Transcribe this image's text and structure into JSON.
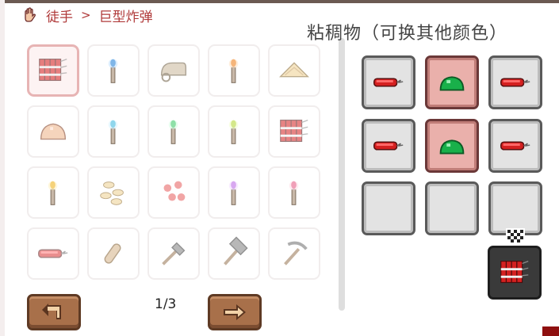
{
  "breadcrumb": {
    "root": "徒手",
    "separator": ">",
    "current": "巨型炸弹"
  },
  "recipe": {
    "title": "粘稠物（可换其他颜色）"
  },
  "pagination": {
    "page": "1/3"
  },
  "item_grid": [
    [
      "dynamite-bundle-icon",
      "blue-torch-icon",
      "grappling-hook-icon",
      "orange-torch-icon",
      "mushroom-stack-icon"
    ],
    [
      "slime-blob-icon",
      "ice-torch-icon",
      "green-torch-icon",
      "yellow-green-torch-icon",
      "dynamite-bundle-icon"
    ],
    [
      "yellow-torch-icon",
      "seeds-icon",
      "gel-drops-icon",
      "purple-torch-icon",
      "pink-torch-icon"
    ],
    [
      "dynamite-stick-icon",
      "rope-icon",
      "shovel-icon",
      "hammer-icon",
      "pickaxe-icon"
    ]
  ],
  "crafting_grid": [
    [
      "dynamite-stick-icon",
      "green-gel-icon",
      "dynamite-stick-icon"
    ],
    [
      "dynamite-stick-icon",
      "green-gel-icon",
      "dynamite-stick-icon"
    ],
    [
      "empty",
      "empty",
      "empty"
    ]
  ],
  "result": "dynamite-bundle-icon",
  "colors": {
    "accent": "#b03a3a",
    "button": "#a8704a",
    "slot_red": "#eab0ab"
  }
}
